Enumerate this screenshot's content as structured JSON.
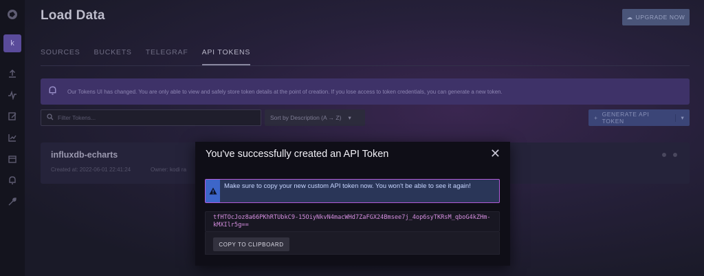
{
  "header": {
    "title": "Load Data",
    "upgrade_label": "UPGRADE NOW"
  },
  "sidebar": {
    "avatar_letter": "k",
    "items": [
      {
        "icon": "upload-icon"
      },
      {
        "icon": "pulse-icon"
      },
      {
        "icon": "edit-icon"
      },
      {
        "icon": "chart-icon"
      },
      {
        "icon": "calendar-icon"
      },
      {
        "icon": "bell-icon"
      },
      {
        "icon": "wrench-icon"
      }
    ]
  },
  "tabs": [
    {
      "label": "SOURCES",
      "active": false
    },
    {
      "label": "BUCKETS",
      "active": false
    },
    {
      "label": "TELEGRAF",
      "active": false
    },
    {
      "label": "API TOKENS",
      "active": true
    }
  ],
  "notice": {
    "text": "Our Tokens UI has changed. You are only able to view and safely store token details at the point of creation. If you lose access to token credentials, you can generate a new token."
  },
  "controls": {
    "filter_placeholder": "Filter Tokens...",
    "sort_label": "Sort by Description (A → Z)",
    "generate_label": "GENERATE API TOKEN"
  },
  "token_card": {
    "name": "influxdb-echarts",
    "created": "Created at: 2022-06-01 22:41:24",
    "owner": "Owner: kodi ra"
  },
  "modal": {
    "title": "You've successfully created an API Token",
    "alert_text": "Make sure to copy your new custom API token now. You won't be able to see it again!",
    "token_value": "tfHTOcJoz8a66PKhRTUbkC9-15OiyNkvN4macWHd7ZaFGX24Bmsee7j_4op6syTKRsM_qboG4kZHm-kMXIlr5g==",
    "copy_label": "COPY TO CLIPBOARD"
  },
  "colors": {
    "accent": "#3d66c9",
    "alert_border": "#b35bd8",
    "token_text": "#d68fe0"
  }
}
